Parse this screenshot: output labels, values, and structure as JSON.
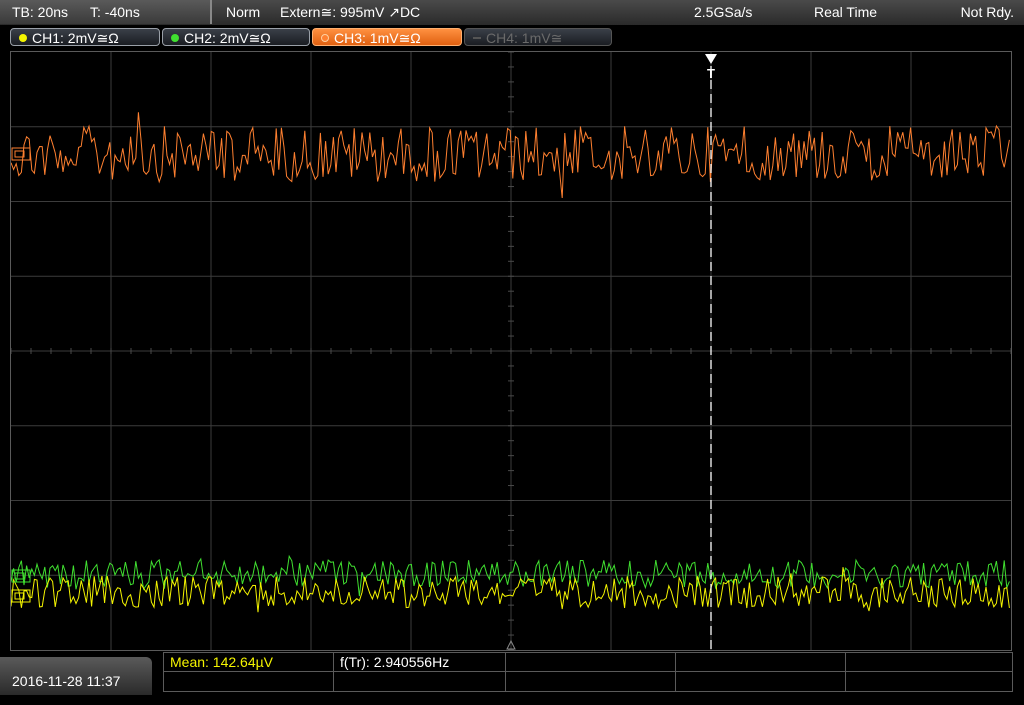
{
  "status": {
    "timebase": "TB: 20ns",
    "trigger_time": "T: -40ns",
    "trigger_mode": "Norm",
    "trigger_source": "Extern≅: 995mV ↗DC",
    "sample_rate": "2.5GSa/s",
    "acq_mode": "Real Time",
    "ready_state": "Not Rdy."
  },
  "channels": [
    {
      "label": "CH1: 2mV≅Ω",
      "color": "#f4f400",
      "active": false
    },
    {
      "label": "CH2: 2mV≅Ω",
      "color": "#40e030",
      "active": false
    },
    {
      "label": "CH3: 1mV≅Ω",
      "color": "#ff8030",
      "active": true
    },
    {
      "label": "CH4: 1mV≅",
      "color": "#555555",
      "active": false
    }
  ],
  "trigger_marker": "T",
  "measurements": {
    "mean": "Mean: 142.64µV",
    "freq": "f(Tr): 2.940556Hz"
  },
  "datetime": "2016-11-28 11:37",
  "colors": {
    "ch1": "#f4f400",
    "ch2": "#40e030",
    "ch3": "#ff8030",
    "grid": "#3c3c3c"
  }
}
